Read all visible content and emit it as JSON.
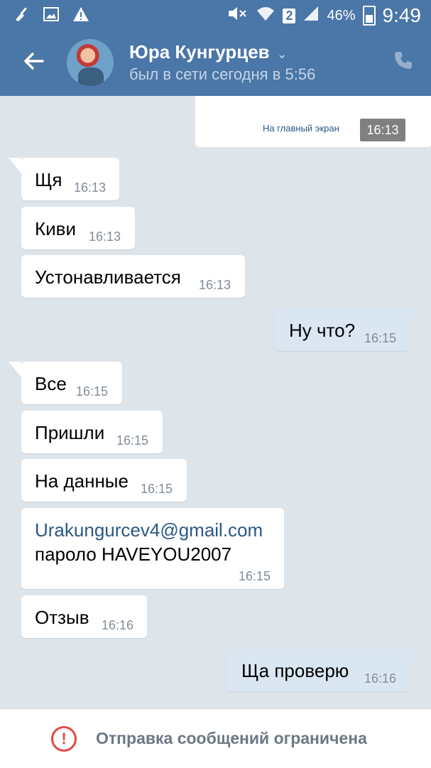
{
  "status_bar": {
    "battery_percent": "46%",
    "time": "9:49",
    "sim_label": "2",
    "icons": [
      "cleaner-icon",
      "image-icon",
      "warning-icon",
      "mute-icon",
      "wifi-icon",
      "signal-icon",
      "battery-icon"
    ]
  },
  "header": {
    "name": "Юра Кунгурцев",
    "last_seen": "был в сети сегодня в 5:56"
  },
  "forward": {
    "label": "На главный экран",
    "time": "16:13"
  },
  "messages": [
    {
      "dir": "in",
      "text": "Щя",
      "time": "16:13"
    },
    {
      "dir": "in",
      "text": "Киви",
      "time": "16:13"
    },
    {
      "dir": "in",
      "text": "Устонавливается",
      "time": "16:13"
    },
    {
      "dir": "out",
      "text": "Ну что?",
      "time": "16:15"
    },
    {
      "dir": "in",
      "text": "Все",
      "time": "16:15"
    },
    {
      "dir": "in",
      "text": "Пришли",
      "time": "16:15"
    },
    {
      "dir": "in",
      "text": "На данные",
      "time": "16:15"
    },
    {
      "dir": "in",
      "link": "Urakungurcev4@gmail.com",
      "text": "пароло HAVEYOU2007",
      "time": "16:15"
    },
    {
      "dir": "in",
      "text": "Отзыв",
      "time": "16:16"
    },
    {
      "dir": "out",
      "text": "Ща проверю",
      "time": "16:16"
    }
  ],
  "footer": {
    "text": "Отправка сообщений ограничена"
  },
  "colors": {
    "header": "#4a76a8",
    "background": "#dde4ea",
    "outgoing_bubble": "#dbe6f3",
    "link": "#2a5885",
    "warning": "#e64646"
  }
}
